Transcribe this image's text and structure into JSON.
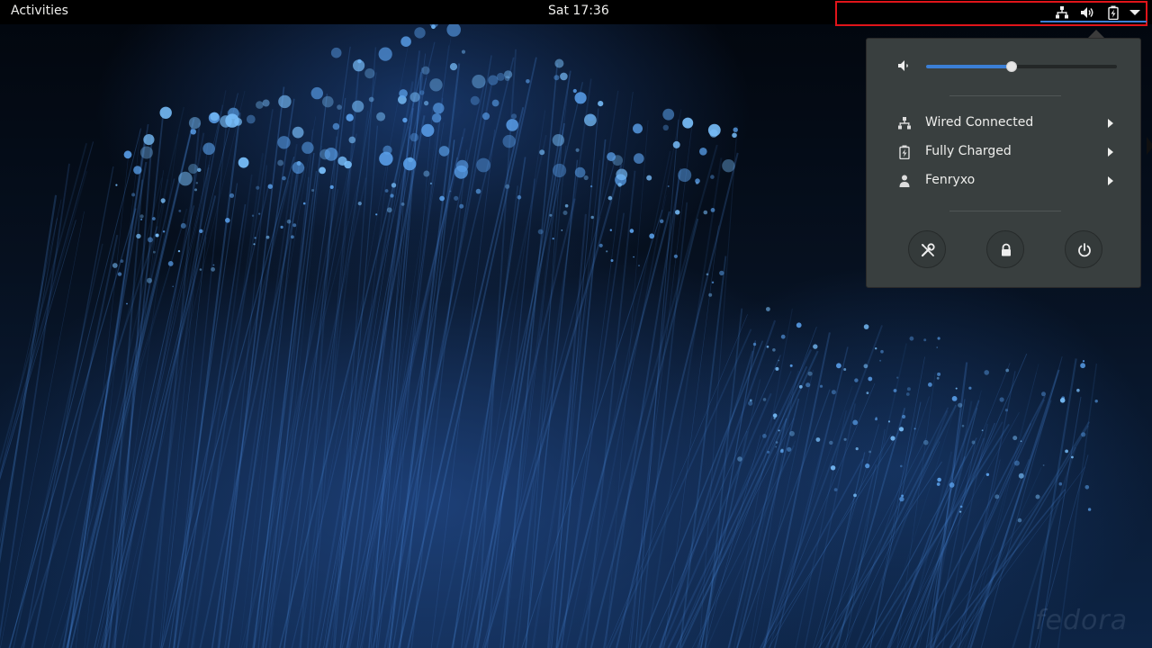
{
  "top_bar": {
    "activities_label": "Activities",
    "clock": "Sat 17:36"
  },
  "tray": {
    "icons": [
      "network-wired-icon",
      "volume-icon",
      "battery-charged-icon",
      "menu-dropdown-icon"
    ],
    "highlight_color": "#e0141a",
    "active_underline_color": "#3b7fd6"
  },
  "system_menu": {
    "volume_level": 0.45,
    "items": [
      {
        "label": "Wired Connected",
        "icon": "network-wired-icon"
      },
      {
        "label": "Fully Charged",
        "icon": "battery-charged-icon"
      },
      {
        "label": "Fenryxo",
        "icon": "user-icon"
      }
    ],
    "actions": [
      "settings-icon",
      "lock-icon",
      "power-icon"
    ],
    "accent_color": "#3b7fd6"
  },
  "wallpaper": {
    "watermark": "fedora"
  }
}
